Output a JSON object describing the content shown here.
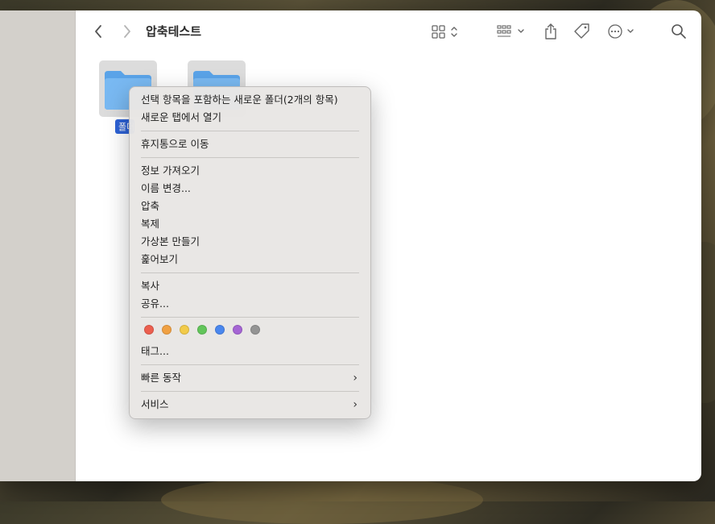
{
  "window": {
    "title": "압축테스트"
  },
  "toolbar": {
    "back_icon": "chevron-left-icon",
    "forward_icon": "chevron-right-icon",
    "view_icon": "grid-view-icon",
    "group_icon": "group-icon",
    "share_icon": "share-icon",
    "tag_icon": "tag-icon",
    "more_icon": "ellipsis-circle-icon",
    "search_icon": "search-icon"
  },
  "folders": [
    {
      "label": "폴더",
      "selected": true
    },
    {
      "label": "",
      "selected": false
    }
  ],
  "context_menu": {
    "items": [
      {
        "label": "선택 항목을 포함하는 새로운 폴더(2개의 항목)"
      },
      {
        "label": "새로운 탭에서 열기"
      },
      {
        "label": "휴지통으로 이동"
      },
      {
        "label": "정보 가져오기"
      },
      {
        "label": "이름 변경..."
      },
      {
        "label": "압축"
      },
      {
        "label": "복제"
      },
      {
        "label": "가상본 만들기"
      },
      {
        "label": "훑어보기"
      },
      {
        "label": "복사"
      },
      {
        "label": "공유..."
      },
      {
        "label": "태그..."
      },
      {
        "label": "빠른 동작"
      },
      {
        "label": "서비스"
      }
    ],
    "tag_colors": [
      {
        "name": "red",
        "color": "#ec5f4f"
      },
      {
        "name": "orange",
        "color": "#f0a042"
      },
      {
        "name": "yellow",
        "color": "#f2cb4a"
      },
      {
        "name": "green",
        "color": "#62c55a"
      },
      {
        "name": "blue",
        "color": "#4a87ee"
      },
      {
        "name": "purple",
        "color": "#a565d4"
      },
      {
        "name": "gray",
        "color": "#949494"
      }
    ],
    "submenu_glyph": "›"
  }
}
